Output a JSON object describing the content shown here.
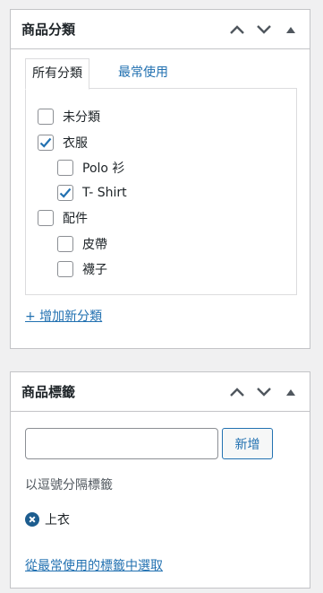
{
  "category_box": {
    "title": "商品分類",
    "tabs": {
      "all": "所有分類",
      "popular": "最常使用"
    },
    "items": [
      {
        "label": "未分類",
        "checked": false
      },
      {
        "label": "衣服",
        "checked": true
      },
      {
        "label": "Polo 衫",
        "checked": false
      },
      {
        "label": "T- Shirt",
        "checked": true
      },
      {
        "label": "配件",
        "checked": false
      },
      {
        "label": "皮帶",
        "checked": false
      },
      {
        "label": "襪子",
        "checked": false
      }
    ],
    "add_link": "+ 增加新分類"
  },
  "tag_box": {
    "title": "商品標籤",
    "input_value": "",
    "add_button": "新增",
    "hint": "以逗號分隔標籤",
    "tags": [
      "上衣"
    ],
    "choose_link": "從最常使用的標籤中選取"
  },
  "colors": {
    "link": "#2271b1",
    "check": "#2271b1",
    "remove_icon": "#1d5d8f"
  },
  "icons": [
    "chevron-up-icon",
    "chevron-down-icon",
    "triangle-up-icon",
    "checkmark-icon",
    "remove-circle-icon"
  ]
}
